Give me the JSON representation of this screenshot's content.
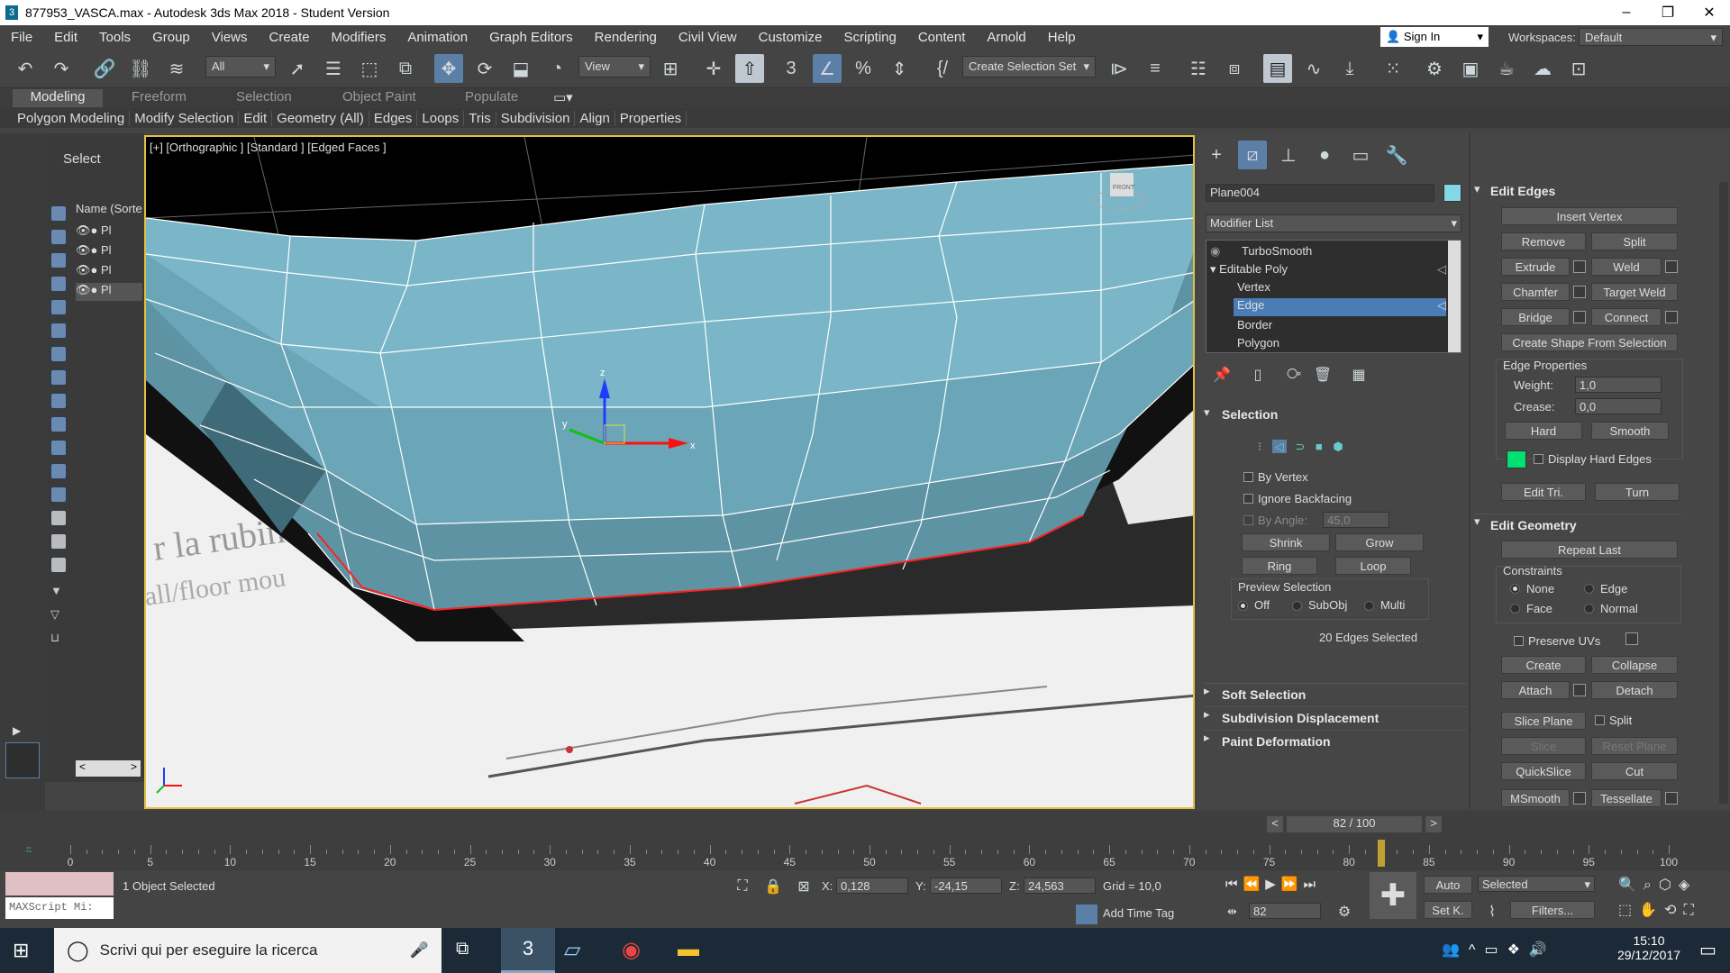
{
  "window": {
    "title": "877953_VASCA.max - Autodesk 3ds Max 2018 - Student Version"
  },
  "menu": [
    "File",
    "Edit",
    "Tools",
    "Group",
    "Views",
    "Create",
    "Modifiers",
    "Animation",
    "Graph Editors",
    "Rendering",
    "Civil View",
    "Customize",
    "Scripting",
    "Content",
    "Arnold",
    "Help"
  ],
  "account": {
    "signin": "Sign In",
    "workspaces_label": "Workspaces:",
    "workspace": "Default"
  },
  "toolbar": {
    "filter": "All",
    "ref_coord": "View",
    "selection_set": "Create Selection Set",
    "snap_3": "3"
  },
  "ribbon": {
    "tabs": [
      "Modeling",
      "Freeform",
      "Selection",
      "Object Paint",
      "Populate"
    ],
    "active_tab": "Modeling",
    "sub": [
      "Polygon Modeling",
      "Modify Selection",
      "Edit",
      "Geometry (All)",
      "Edges",
      "Loops",
      "Tris",
      "Subdivision",
      "Align",
      "Properties"
    ]
  },
  "scene_explorer": {
    "title": "Select",
    "column": "Name (Sorte",
    "rows": [
      "Pl",
      "Pl",
      "Pl",
      "Pl"
    ]
  },
  "viewport": {
    "label": "[+] [Orthographic ] [Standard ] [Edged Faces ]",
    "gizmo_z": "z",
    "gizmo_x": "x",
    "gizmo_y": "y",
    "cube_label": "FRONT"
  },
  "command_panel": {
    "object_name": "Plane004",
    "object_color": "#86d7e6",
    "modifier_list": "Modifier List",
    "stack": [
      "TurboSmooth",
      "Editable Poly",
      "Vertex",
      "Edge",
      "Border",
      "Polygon"
    ],
    "selected_stack": "Edge",
    "selection": {
      "title": "Selection",
      "by_vertex": "By Vertex",
      "ignore_backfacing": "Ignore Backfacing",
      "by_angle": "By Angle:",
      "by_angle_val": "45,0",
      "shrink": "Shrink",
      "grow": "Grow",
      "ring": "Ring",
      "loop": "Loop",
      "preview": "Preview Selection",
      "off": "Off",
      "subobj": "SubObj",
      "multi": "Multi",
      "status": "20 Edges Selected"
    },
    "rollouts": [
      "Soft Selection",
      "Subdivision Displacement",
      "Paint Deformation"
    ],
    "edit_edges": {
      "title": "Edit Edges",
      "insert_vertex": "Insert Vertex",
      "remove": "Remove",
      "split": "Split",
      "extrude": "Extrude",
      "weld": "Weld",
      "chamfer": "Chamfer",
      "target_weld": "Target Weld",
      "bridge": "Bridge",
      "connect": "Connect",
      "create_shape": "Create Shape From Selection",
      "edge_props": "Edge Properties",
      "weight": "Weight:",
      "weight_val": "1,0",
      "crease": "Crease:",
      "crease_val": "0,0",
      "hard": "Hard",
      "smooth": "Smooth",
      "display_hard": "Display Hard Edges",
      "edit_tri": "Edit Tri.",
      "turn": "Turn"
    },
    "edit_geometry": {
      "title": "Edit Geometry",
      "repeat_last": "Repeat Last",
      "constraints": "Constraints",
      "none": "None",
      "edge": "Edge",
      "face": "Face",
      "normal": "Normal",
      "preserve_uvs": "Preserve UVs",
      "create": "Create",
      "collapse": "Collapse",
      "attach": "Attach",
      "detach": "Detach",
      "slice_plane": "Slice Plane",
      "split": "Split",
      "slice": "Slice",
      "reset_plane": "Reset Plane",
      "quickslice": "QuickSlice",
      "cut": "Cut",
      "msmooth": "MSmooth",
      "tessellate": "Tessellate"
    }
  },
  "timeline": {
    "frame": "82 / 100",
    "ticks": [
      "0",
      "5",
      "10",
      "15",
      "20",
      "25",
      "30",
      "35",
      "40",
      "45",
      "50",
      "55",
      "60",
      "65",
      "70",
      "75",
      "80",
      "85",
      "90",
      "95",
      "100"
    ],
    "frame_fraction": 0.82
  },
  "status": {
    "maxscript": "MAXScript Mi:",
    "selected_text": "1 Object Selected",
    "x_label": "X:",
    "x": "0,128",
    "y_label": "Y:",
    "y": "-24,15",
    "z_label": "Z:",
    "z": "24,563",
    "grid": "Grid = 10,0",
    "add_time_tag": "Add Time Tag",
    "frame_spin": "82",
    "auto": "Auto",
    "set_key": "Set K.",
    "key_filter": "Selected",
    "filters": "Filters..."
  },
  "taskbar": {
    "search": "Scrivi qui per eseguire la ricerca",
    "time": "15:10",
    "date": "29/12/2017"
  },
  "colors": {
    "accent_blue": "#5b7fa6",
    "selection_red": "#ff2020",
    "mesh": "#7ab6c7",
    "hard_edge": "#00e070"
  }
}
